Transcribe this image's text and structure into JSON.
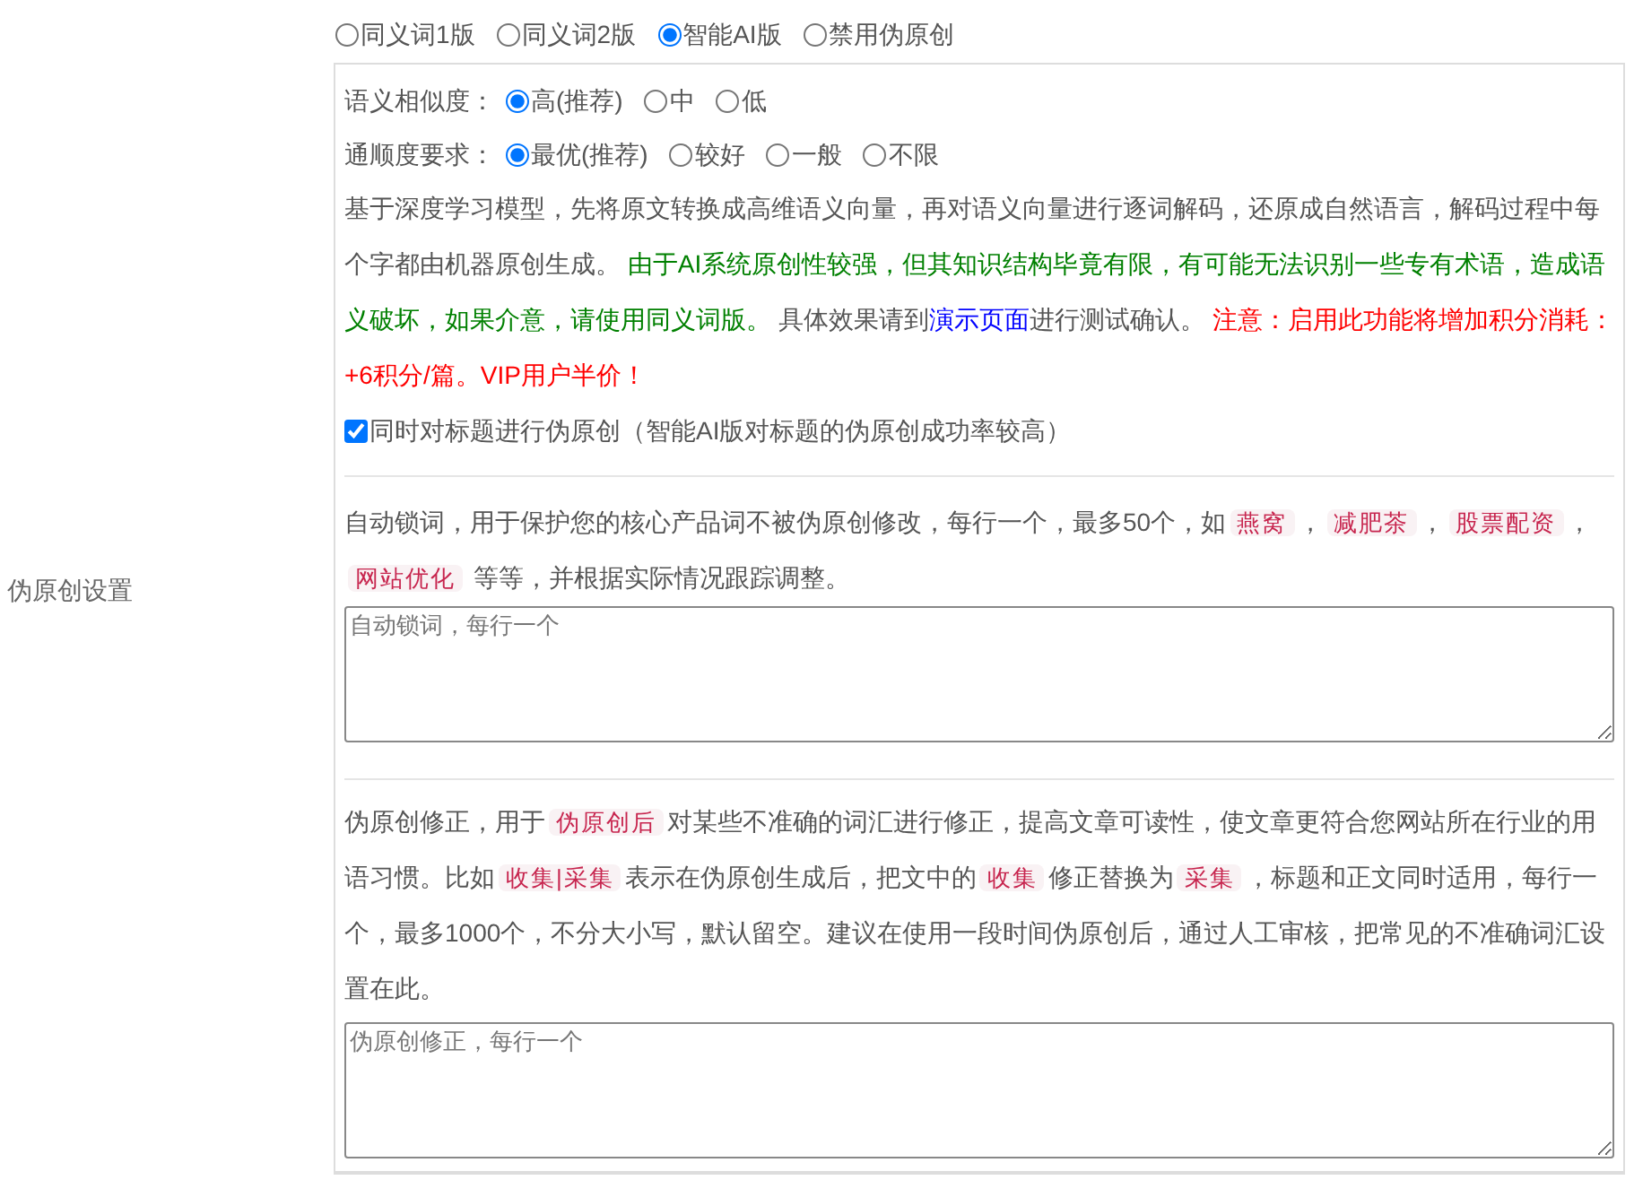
{
  "section_label": "伪原创设置",
  "modes": [
    {
      "label": "同义词1版",
      "selected": false
    },
    {
      "label": "同义词2版",
      "selected": false
    },
    {
      "label": "智能AI版",
      "selected": true
    },
    {
      "label": "禁用伪原创",
      "selected": false
    }
  ],
  "similarity": {
    "label": "语义相似度：",
    "options": [
      {
        "label": "高(推荐)",
        "selected": true
      },
      {
        "label": "中",
        "selected": false
      },
      {
        "label": "低",
        "selected": false
      }
    ]
  },
  "fluency": {
    "label": "通顺度要求：",
    "options": [
      {
        "label": "最优(推荐)",
        "selected": true
      },
      {
        "label": "较好",
        "selected": false
      },
      {
        "label": "一般",
        "selected": false
      },
      {
        "label": "不限",
        "selected": false
      }
    ]
  },
  "description": [
    {
      "kind": "plain",
      "text": "基于深度学习模型，先将原文转换成高维语义向量，再对语义向量进行逐词解码，还原成自然语言，解码过程中每个字都由机器原创生成。 "
    },
    {
      "kind": "note",
      "text": "由于AI系统原创性较强，但其知识结构毕竟有限，有可能无法识别一些专有术语，造成语义破坏，如果介意，请使用同义词版。"
    },
    {
      "kind": "plain",
      "text": " 具体效果请到"
    },
    {
      "kind": "link",
      "text": "演示页面"
    },
    {
      "kind": "plain",
      "text": "进行测试确认。 "
    },
    {
      "kind": "warning",
      "text": "注意：启用此功能将增加积分消耗：+6积分/篇。VIP用户半价！"
    }
  ],
  "title_option": {
    "label": "同时对标题进行伪原创（智能AI版对标题的伪原创成功率较高）",
    "checked": true
  },
  "lock_words": {
    "text": [
      {
        "kind": "plain",
        "text": "自动锁词，用于保护您的核心产品词不被伪原创修改，每行一个，最多50个，如"
      },
      {
        "kind": "tag",
        "text": "燕窝"
      },
      {
        "kind": "plain",
        "text": "，"
      },
      {
        "kind": "tag",
        "text": "减肥茶"
      },
      {
        "kind": "plain",
        "text": "，"
      },
      {
        "kind": "tag",
        "text": "股票配资"
      },
      {
        "kind": "plain",
        "text": "，"
      },
      {
        "kind": "tag",
        "text": "网站优化"
      },
      {
        "kind": "plain",
        "text": " 等等，并根据实际情况跟踪调整。"
      }
    ],
    "placeholder": "自动锁词，每行一个"
  },
  "correction": {
    "text": [
      {
        "kind": "plain",
        "text": "伪原创修正，用于"
      },
      {
        "kind": "tag",
        "text": "伪原创后"
      },
      {
        "kind": "plain",
        "text": "对某些不准确的词汇进行修正，提高文章可读性，使文章更符合您网站所在行业的用语习惯。比如"
      },
      {
        "kind": "tag",
        "text": "收集|采集"
      },
      {
        "kind": "plain",
        "text": "表示在伪原创生成后，把文中的"
      },
      {
        "kind": "tag",
        "text": "收集"
      },
      {
        "kind": "plain",
        "text": "修正替换为"
      },
      {
        "kind": "tag",
        "text": "采集"
      },
      {
        "kind": "plain",
        "text": "，标题和正文同时适用，每行一个，最多1000个，不分大小写，默认留空。建议在使用一段时间伪原创后，通过人工审核，把常见的不准确词汇设置在此。"
      }
    ],
    "placeholder": "伪原创修正，每行一个"
  }
}
